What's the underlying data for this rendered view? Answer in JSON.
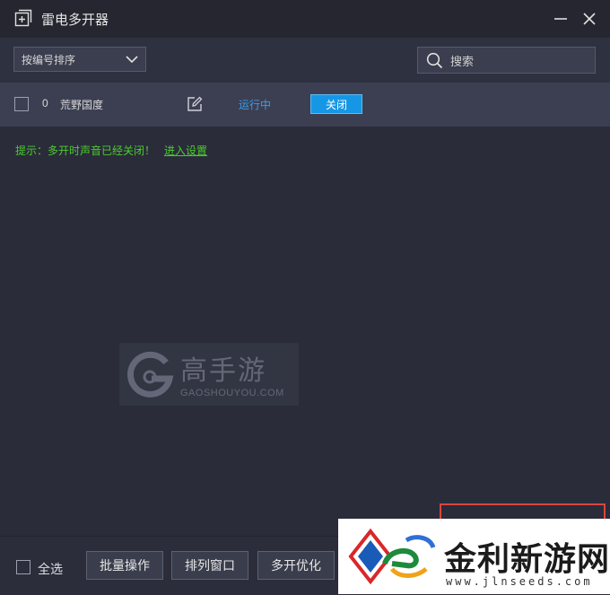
{
  "window": {
    "title": "雷电多开器",
    "minimize_icon": "minimize-icon",
    "close_icon": "close-icon"
  },
  "toolbar": {
    "sort_label": "按编号排序",
    "search_placeholder": "搜索"
  },
  "instances": [
    {
      "index": "0",
      "name": "荒野国度",
      "status": "运行中",
      "action_label": "关闭"
    }
  ],
  "notice": {
    "text": "提示：多开时声音已经关闭！",
    "link": "进入设置"
  },
  "watermark": {
    "name": "高手游",
    "domain": "GAOSHOUYOU.COM"
  },
  "bottom": {
    "select_all": "全选",
    "buttons": [
      "批量操作",
      "排列窗口",
      "多开优化"
    ]
  },
  "site_badge": {
    "name": "金利新游网",
    "url": "www.jlnseeds.com"
  },
  "colors": {
    "accent": "#1597e6",
    "status_running": "#3a9de8",
    "notice": "#4ccb2f",
    "highlight_frame": "#d9463f"
  }
}
